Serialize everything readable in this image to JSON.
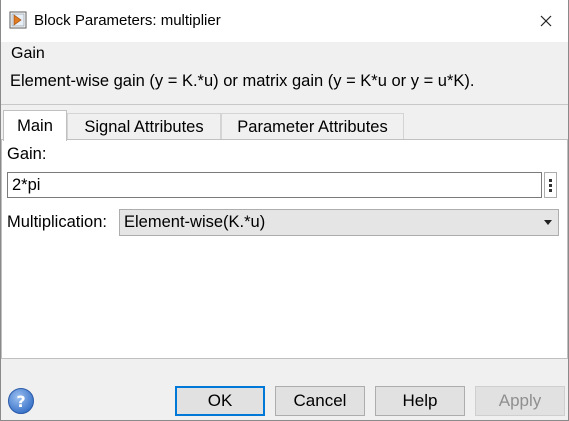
{
  "window": {
    "title": "Block Parameters: multiplier"
  },
  "description": {
    "heading": "Gain",
    "text": "Element-wise gain (y = K.*u) or matrix gain (y = K*u or y = u*K)."
  },
  "tabs": [
    {
      "label": "Main",
      "active": true
    },
    {
      "label": "Signal Attributes",
      "active": false
    },
    {
      "label": "Parameter Attributes",
      "active": false
    }
  ],
  "main": {
    "gain_label": "Gain:",
    "gain_value": "2*pi",
    "multiplication_label": "Multiplication:",
    "multiplication_value": "Element-wise(K.*u)"
  },
  "buttons": {
    "ok": "OK",
    "cancel": "Cancel",
    "help": "Help",
    "apply": "Apply"
  },
  "colors": {
    "focus_border": "#0078d7",
    "help_icon": "#3a73c9",
    "disabled_text": "#8f8f8f"
  },
  "icons": {
    "title": "simulink-block-icon",
    "close": "close-icon",
    "help": "help-icon",
    "gain_menu": "vertical-ellipsis-icon",
    "dropdown": "chevron-down-icon"
  }
}
